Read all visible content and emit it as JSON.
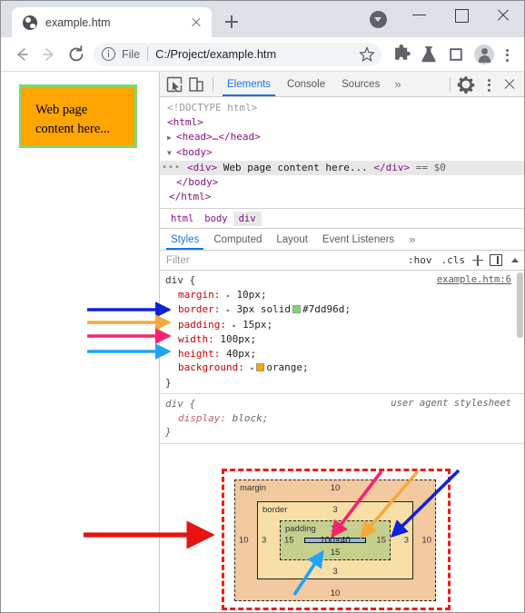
{
  "window": {
    "controls": {
      "minimize": "minimize",
      "maximize": "maximize",
      "close": "close"
    },
    "download_badge": "download-indicator"
  },
  "tab": {
    "title": "example.htm",
    "favicon": "globe-icon",
    "close_label": "×",
    "new_tab_label": "+"
  },
  "toolbar": {
    "back": "back",
    "forward": "forward",
    "reload": "reload",
    "scheme_label": "File",
    "url": "C:/Project/example.htm",
    "bookmark": "star-icon",
    "extensions": "puzzle-icon",
    "experiments": "flask-icon",
    "side_panel": "panel-icon",
    "profile": "avatar",
    "menu": "kebab-icon"
  },
  "page": {
    "content_text_line1": "Web page",
    "content_text_line2": "content here...",
    "background_color": "#ffa500",
    "border_color": "#7dd96d"
  },
  "devtools": {
    "inspect_icon": "inspect-element-icon",
    "device_icon": "device-toolbar-icon",
    "tabs": [
      {
        "label": "Elements",
        "active": true
      },
      {
        "label": "Console",
        "active": false
      },
      {
        "label": "Sources",
        "active": false
      }
    ],
    "more_tabs": "»",
    "settings_icon": "gear-icon",
    "more_options_icon": "kebab-icon",
    "close_icon": "close-icon",
    "dom": {
      "lines": [
        {
          "text": "<!DOCTYPE html>",
          "kind": "doctype"
        },
        {
          "text": "<html>",
          "kind": "tag"
        },
        {
          "text": "<head>…</head>",
          "kind": "tag",
          "twisty": "▶"
        },
        {
          "text": "<body>",
          "kind": "tag",
          "twisty": "▼"
        },
        {
          "text": "<div> Web page content here... </div> == $0",
          "kind": "selected"
        },
        {
          "text": "</body>",
          "kind": "tag"
        },
        {
          "text": "</html>",
          "kind": "tag"
        }
      ],
      "selected_div_open": "<div>",
      "selected_div_text": "Web page content here...",
      "selected_div_close": "</div>",
      "selected_div_marker": "== $0",
      "ellipsis": "•••"
    },
    "breadcrumbs": [
      {
        "label": "html",
        "active": false
      },
      {
        "label": "body",
        "active": false
      },
      {
        "label": "div",
        "active": true
      }
    ],
    "style_tabs": [
      {
        "label": "Styles",
        "active": true
      },
      {
        "label": "Computed",
        "active": false
      },
      {
        "label": "Layout",
        "active": false
      },
      {
        "label": "Event Listeners",
        "active": false
      }
    ],
    "style_tabs_more": "»",
    "filter": {
      "placeholder": "Filter",
      "hov": ":hov",
      "cls": ".cls",
      "new_rule": "+",
      "toggle_panel": "toggle-sidebar-icon"
    },
    "rules": [
      {
        "selector": "div {",
        "closing": "}",
        "source": "example.htm:6",
        "source_kind": "link",
        "declarations": [
          {
            "prop": "margin:",
            "expand": "▸",
            "value": "10px;",
            "swatch": null
          },
          {
            "prop": "border:",
            "expand": "▸",
            "value": "3px solid",
            "swatch": "#7dd96d",
            "value_after": "#7dd96d;"
          },
          {
            "prop": "padding:",
            "expand": "▸",
            "value": "15px;",
            "swatch": null
          },
          {
            "prop": "width:",
            "expand": null,
            "value": "100px;",
            "swatch": null
          },
          {
            "prop": "height:",
            "expand": null,
            "value": "40px;",
            "swatch": null
          },
          {
            "prop": "background:",
            "expand": "▸",
            "value": "orange;",
            "swatch": "#ffa500"
          }
        ]
      },
      {
        "selector": "div {",
        "closing": "}",
        "source": "user agent stylesheet",
        "source_kind": "ua",
        "declarations": [
          {
            "prop": "display:",
            "expand": null,
            "value": "block;",
            "swatch": null
          }
        ]
      }
    ],
    "box_model": {
      "margin_label": "margin",
      "margin_top": "10",
      "margin_bottom": "10",
      "margin_left": "10",
      "margin_right": "10",
      "border_label": "border",
      "border_top": "3",
      "border_bottom": "3",
      "border_left": "3",
      "border_right": "3",
      "padding_label": "padding",
      "padding_top": "15",
      "padding_bottom": "15",
      "padding_left": "15",
      "padding_right": "15",
      "content_size": "100×40",
      "colors": {
        "margin": "#f3c9a0",
        "border": "#f8dfa6",
        "padding": "#c5cf8e",
        "content": "#8fbdd3",
        "highlight": "#ee1b1b"
      }
    }
  },
  "annotations": {
    "arrow_margin_color": "#0e22d8",
    "arrow_border_color": "#f5a93c",
    "arrow_padding_color": "#f5246e",
    "arrow_width_color": "#23a3f5",
    "arrow_boxmodel_color": "#e81313"
  }
}
